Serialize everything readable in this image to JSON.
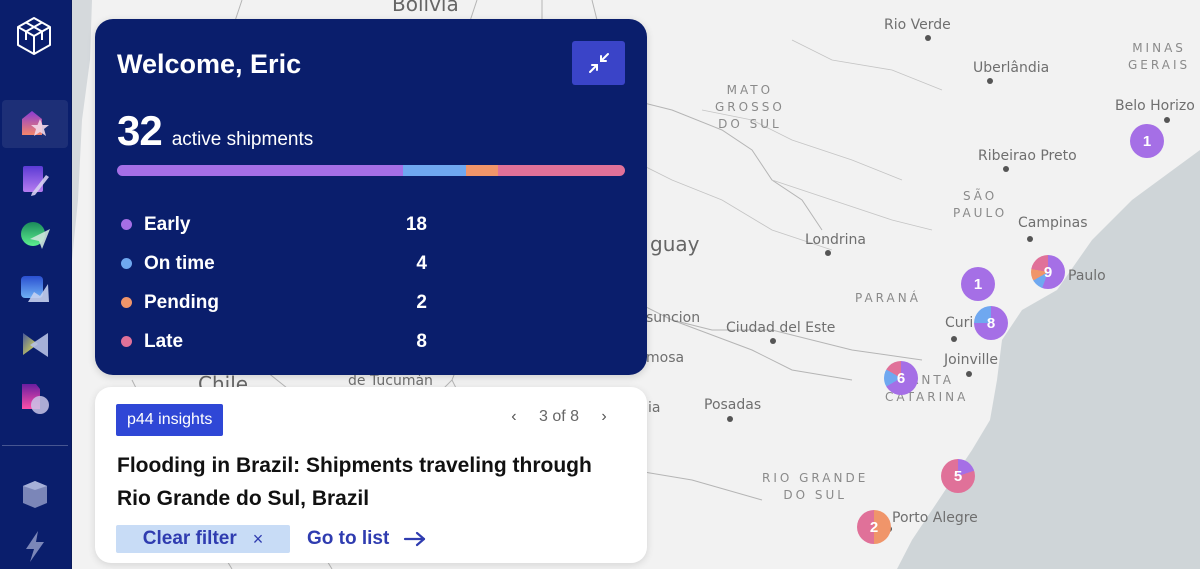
{
  "sidebar": {
    "items": [
      {
        "name": "home",
        "icon": "home-star-icon",
        "active": true
      },
      {
        "name": "edit",
        "icon": "document-pen-icon",
        "active": false
      },
      {
        "name": "send",
        "icon": "paper-plane-icon",
        "active": false
      },
      {
        "name": "analytics",
        "icon": "chart-area-icon",
        "active": false
      },
      {
        "name": "media",
        "icon": "playback-icon",
        "active": false
      },
      {
        "name": "reports",
        "icon": "document-pie-icon",
        "active": false
      }
    ],
    "bottom_items": [
      {
        "name": "packages",
        "icon": "cube-icon"
      },
      {
        "name": "automations",
        "icon": "lightning-icon"
      }
    ]
  },
  "welcome": {
    "title": "Welcome, Eric",
    "collapse_icon": "collapse-arrows-icon",
    "count": "32",
    "count_label": "active shipments",
    "statuses": [
      {
        "label": "Early",
        "value": 18,
        "display": "18",
        "color": "#a56fe6"
      },
      {
        "label": "On time",
        "value": 4,
        "display": "4",
        "color": "#6fa8f0"
      },
      {
        "label": "Pending",
        "value": 2,
        "display": "2",
        "color": "#f0956a"
      },
      {
        "label": "Late",
        "value": 8,
        "display": "8",
        "color": "#e07199"
      }
    ]
  },
  "insights": {
    "badge": "p44 insights",
    "pager": "3 of 8",
    "prev_icon": "chevron-left-icon",
    "next_icon": "chevron-right-icon",
    "title": "Flooding in Brazil: Shipments traveling through Rio Grande do Sul, Brazil",
    "clear_filter": "Clear filter",
    "clear_icon": "×",
    "goto_list": "Go to list"
  },
  "map": {
    "country_labels": [
      "Bolivia",
      "guay",
      "Chile"
    ],
    "region_labels": [
      "MATO\nGROSSO\nDO SUL",
      "MINAS\nGERAIS",
      "SÃO\nPAULO",
      "PARANÁ",
      "SANTA\nCATARINA",
      "RIO GRANDE\nDO SUL"
    ],
    "cities": [
      "Rio Verde",
      "Uberlândia",
      "Belo Horizo",
      "Ribeirao Preto",
      "Campinas",
      "Londrina",
      "Paulo",
      "Curi",
      "Joinville",
      "suncion",
      "Ciudad del Este",
      "mosa",
      "de Tucumán",
      "Posadas",
      "ia",
      "Porto Alegre"
    ],
    "clusters": [
      {
        "count": "1",
        "segments": [
          {
            "color": "#a56fe6",
            "value": 1
          }
        ]
      },
      {
        "count": "9",
        "segments": [
          {
            "color": "#a56fe6",
            "value": 5
          },
          {
            "color": "#6fa8f0",
            "value": 1
          },
          {
            "color": "#f0956a",
            "value": 1
          },
          {
            "color": "#e07199",
            "value": 2
          }
        ]
      },
      {
        "count": "1",
        "segments": [
          {
            "color": "#a56fe6",
            "value": 1
          }
        ]
      },
      {
        "count": "8",
        "segments": [
          {
            "color": "#a56fe6",
            "value": 6
          },
          {
            "color": "#6fa8f0",
            "value": 2
          }
        ]
      },
      {
        "count": "6",
        "segments": [
          {
            "color": "#a56fe6",
            "value": 4
          },
          {
            "color": "#6fa8f0",
            "value": 1
          },
          {
            "color": "#e07199",
            "value": 1
          }
        ]
      },
      {
        "count": "5",
        "segments": [
          {
            "color": "#a56fe6",
            "value": 1
          },
          {
            "color": "#e07199",
            "value": 4
          }
        ]
      },
      {
        "count": "2",
        "segments": [
          {
            "color": "#f0956a",
            "value": 1
          },
          {
            "color": "#e07199",
            "value": 1
          }
        ]
      }
    ]
  }
}
